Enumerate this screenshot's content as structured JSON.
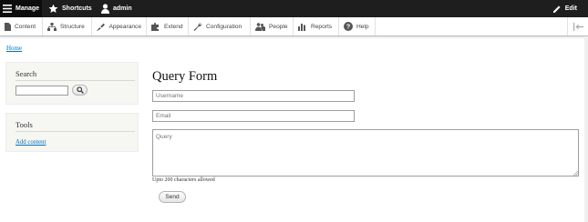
{
  "toolbar": {
    "manage": "Manage",
    "shortcuts": "Shortcuts",
    "user": "admin",
    "edit": "Edit"
  },
  "tray": {
    "items": [
      {
        "label": "Content",
        "icon": "page-icon"
      },
      {
        "label": "Structure",
        "icon": "sitemap-icon"
      },
      {
        "label": "Appearance",
        "icon": "paint-icon"
      },
      {
        "label": "Extend",
        "icon": "puzzle-icon"
      },
      {
        "label": "Configuration",
        "icon": "wrench-icon"
      },
      {
        "label": "People",
        "icon": "people-icon"
      },
      {
        "label": "Reports",
        "icon": "bar-chart-icon"
      },
      {
        "label": "Help",
        "icon": "help-icon"
      }
    ]
  },
  "breadcrumb": {
    "home": "Home"
  },
  "sidebar": {
    "search_title": "Search",
    "tools_title": "Tools",
    "tools_link": "Add content"
  },
  "form": {
    "title": "Query Form",
    "username_placeholder": "Username",
    "email_placeholder": "Email",
    "query_placeholder": "Query",
    "help_text": "Upto 200 characters allowed",
    "send_label": "Send"
  },
  "colors": {
    "toolbar_bg": "#1e1e1e",
    "link": "#0071b8",
    "block_bg": "#f6f6f2"
  }
}
